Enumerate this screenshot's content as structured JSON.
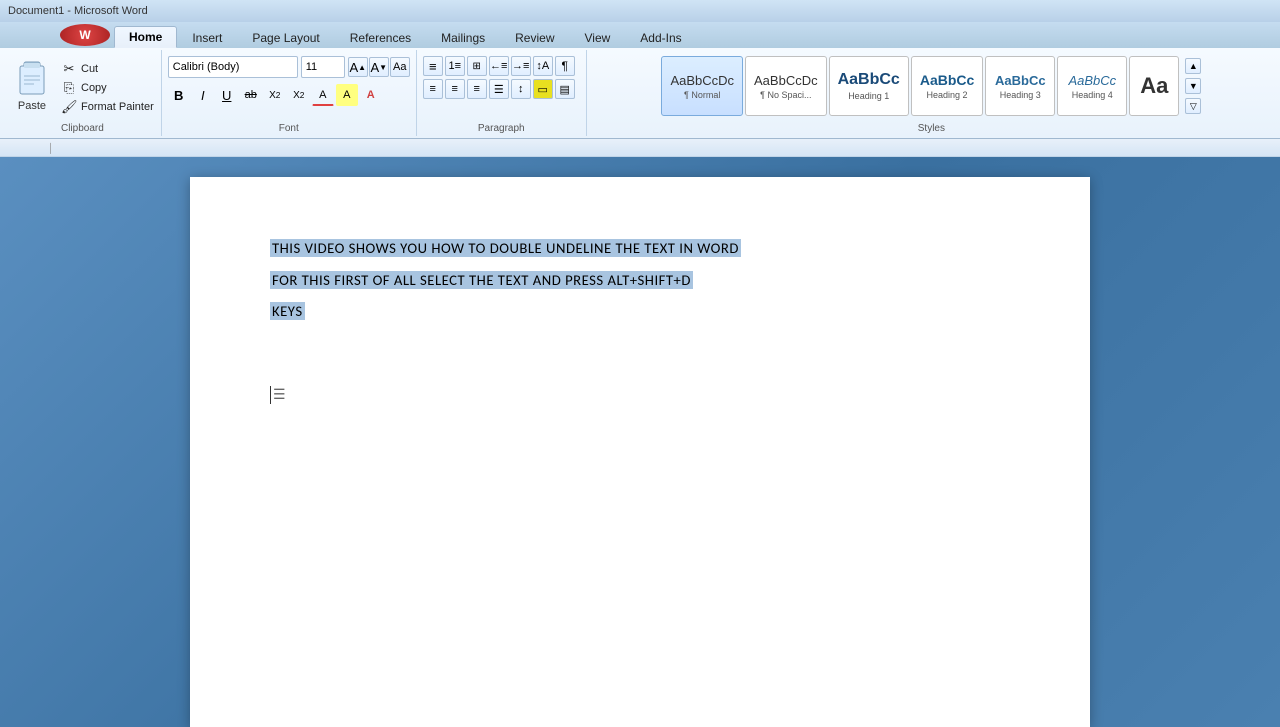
{
  "titlebar": {
    "text": "Document1 - Microsoft Word"
  },
  "tabs": [
    {
      "id": "home",
      "label": "Home",
      "active": true
    },
    {
      "id": "insert",
      "label": "Insert",
      "active": false
    },
    {
      "id": "pagelayout",
      "label": "Page Layout",
      "active": false
    },
    {
      "id": "references",
      "label": "References",
      "active": false
    },
    {
      "id": "mailings",
      "label": "Mailings",
      "active": false
    },
    {
      "id": "review",
      "label": "Review",
      "active": false
    },
    {
      "id": "view",
      "label": "View",
      "active": false
    },
    {
      "id": "addins",
      "label": "Add-Ins",
      "active": false
    }
  ],
  "clipboard": {
    "paste_label": "Paste",
    "cut_label": "Cut",
    "copy_label": "Copy",
    "format_painter_label": "Format Painter",
    "group_label": "Clipboard"
  },
  "font": {
    "name": "Calibri (Body)",
    "size": "11",
    "group_label": "Font",
    "bold": "B",
    "italic": "I",
    "underline": "U",
    "strikethrough": "ab",
    "subscript": "X₂",
    "superscript": "X²",
    "text_color": "A",
    "highlight": "A"
  },
  "paragraph": {
    "group_label": "Paragraph"
  },
  "styles": {
    "group_label": "Styles",
    "items": [
      {
        "id": "normal",
        "preview": "AaBbCcDc",
        "label": "¶ Normal",
        "active": true
      },
      {
        "id": "nospace",
        "preview": "AaBbCcDc",
        "label": "¶ No Spaci...",
        "active": false
      },
      {
        "id": "h1",
        "preview": "AaBbCc",
        "label": "Heading 1",
        "active": false
      },
      {
        "id": "h2",
        "preview": "AaBbCc",
        "label": "Heading 2",
        "active": false
      },
      {
        "id": "h3",
        "preview": "AaBbCc",
        "label": "Heading 3",
        "active": false
      },
      {
        "id": "h4",
        "preview": "AaBbCc",
        "label": "Heading 4",
        "active": false
      },
      {
        "id": "more",
        "preview": "Aa",
        "label": "",
        "active": false
      }
    ]
  },
  "document": {
    "lines": [
      {
        "text": "THIS VIDEO SHOWS YOU HOW TO DOUBLE UNDELINE THE TEXT IN WORD",
        "selected": true
      },
      {
        "text": "FOR THIS FIRST OF ALL SELECT THE TEXT AND PRESS ALT+SHIFT+D",
        "selected": true
      },
      {
        "text": "KEYS",
        "selected": true
      }
    ],
    "cursor_line": ""
  }
}
